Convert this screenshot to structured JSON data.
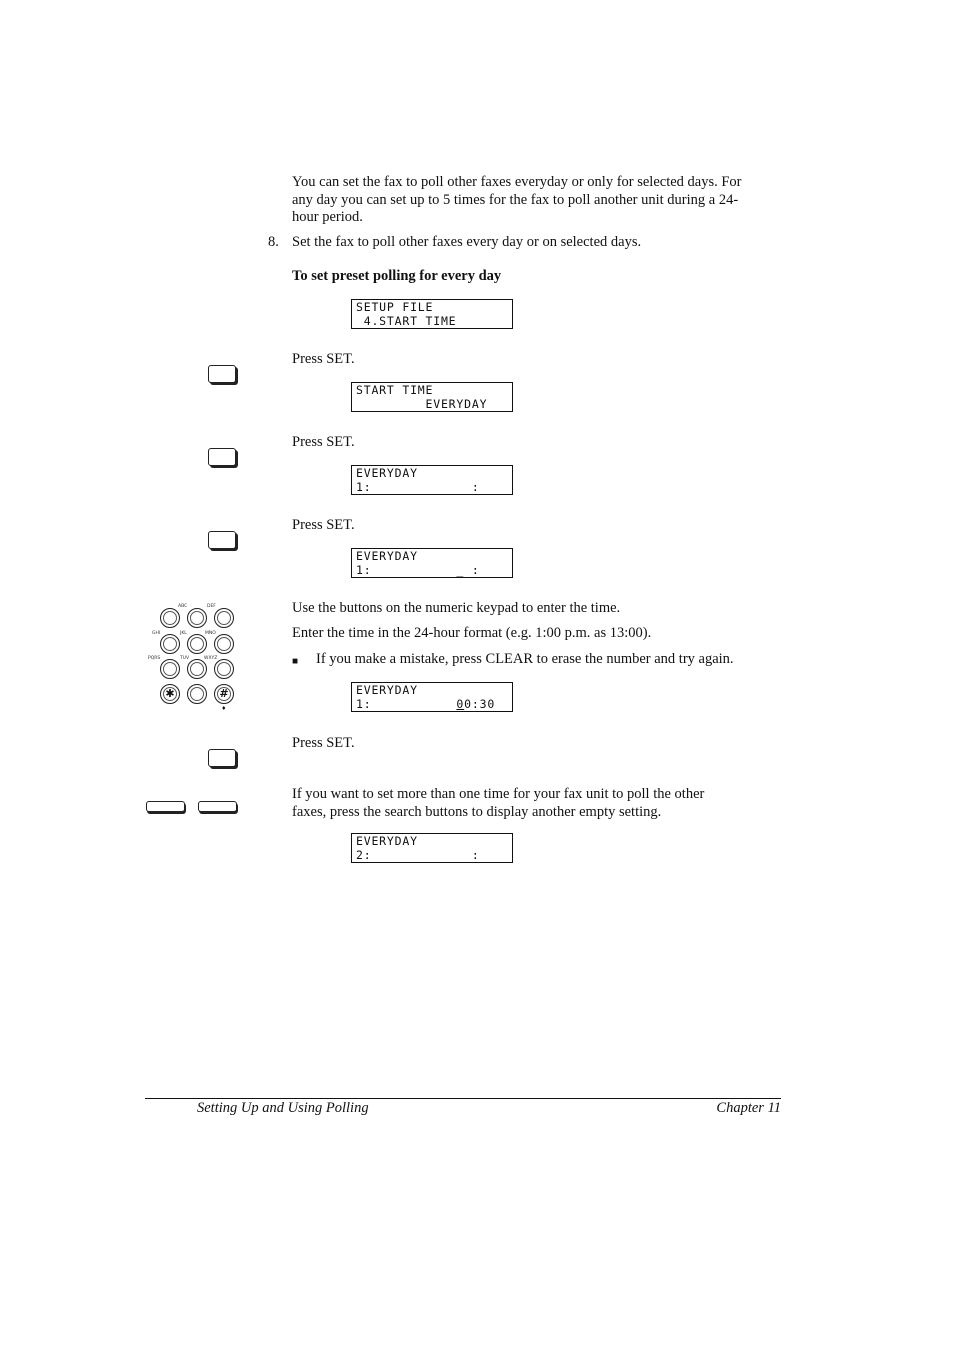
{
  "intro": {
    "line1": "You can set the fax to poll other faxes everyday or only for selected days. For",
    "line2": "any day you can set up to 5 times for the fax to poll another unit during a 24-",
    "line3": "hour period."
  },
  "step": {
    "number": "8.",
    "text": "Set the fax to poll other faxes every day or on selected days."
  },
  "subheading": "To set preset polling for every day",
  "lcd_displays": [
    {
      "line1": "SETUP FILE",
      "line2": " 4.START TIME"
    },
    {
      "line1": "START TIME",
      "line2": "         EVERYDAY"
    },
    {
      "line1": "EVERYDAY",
      "line2": "1:             :"
    },
    {
      "line1": "EVERYDAY",
      "line2": "1:           _ :"
    },
    {
      "line1": "EVERYDAY",
      "line2": "1:           00:30"
    },
    {
      "line1": "EVERYDAY",
      "line2": "2:             :"
    }
  ],
  "instructions": {
    "press_set_1": "Press SET.",
    "press_set_2": "Press SET.",
    "press_set_3": "Press SET.",
    "keypad_1": "Use the buttons on the numeric keypad to enter the time.",
    "keypad_2": "Enter the time in the 24-hour format (e.g. 1:00 p.m. as 13:00).",
    "bullet_symbol": "■",
    "bullet_text": "If you make a mistake, press CLEAR to erase the number and try again.",
    "press_set_4": "Press SET.",
    "search_line1": "If you want to set more than one time for your fax unit to poll the other",
    "search_line2": "faxes, press the search buttons to display another empty setting."
  },
  "keypad": {
    "labels": [
      "ABC",
      "DEF",
      "GHI",
      "JKL",
      "MNO",
      "PQRS",
      "TUV",
      "WXYZ"
    ],
    "star": "✱",
    "hash": "#",
    "hash_marker": "♦"
  },
  "footer": {
    "left": "Setting Up and Using Polling",
    "right": "Chapter 11"
  }
}
